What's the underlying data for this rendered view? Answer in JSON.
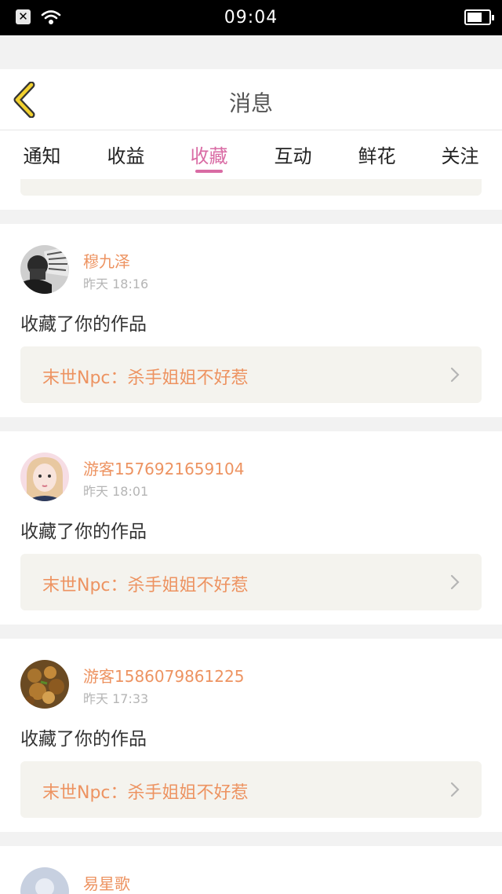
{
  "status_bar": {
    "time": "09:04",
    "battery_level": 0.7
  },
  "header": {
    "title": "消息"
  },
  "tabs": [
    {
      "label": "通知"
    },
    {
      "label": "收益"
    },
    {
      "label": "收藏"
    },
    {
      "label": "互动"
    },
    {
      "label": "鲜花"
    },
    {
      "label": "关注"
    }
  ],
  "active_tab": "收藏",
  "colors": {
    "accent": "#d96ba4",
    "username": "#ed9361",
    "work_box_bg": "#f4f3ee"
  },
  "messages": [
    {
      "username": "穆九泽",
      "time": "昨天 18:16",
      "action": "收藏了你的作品",
      "work_title": "末世Npc：杀手姐姐不好惹"
    },
    {
      "username": "游客1576921659104",
      "time": "昨天 18:01",
      "action": "收藏了你的作品",
      "work_title": "末世Npc：杀手姐姐不好惹"
    },
    {
      "username": "游客1586079861225",
      "time": "昨天 17:33",
      "action": "收藏了你的作品",
      "work_title": "末世Npc：杀手姐姐不好惹"
    },
    {
      "username": "易星歌"
    }
  ]
}
